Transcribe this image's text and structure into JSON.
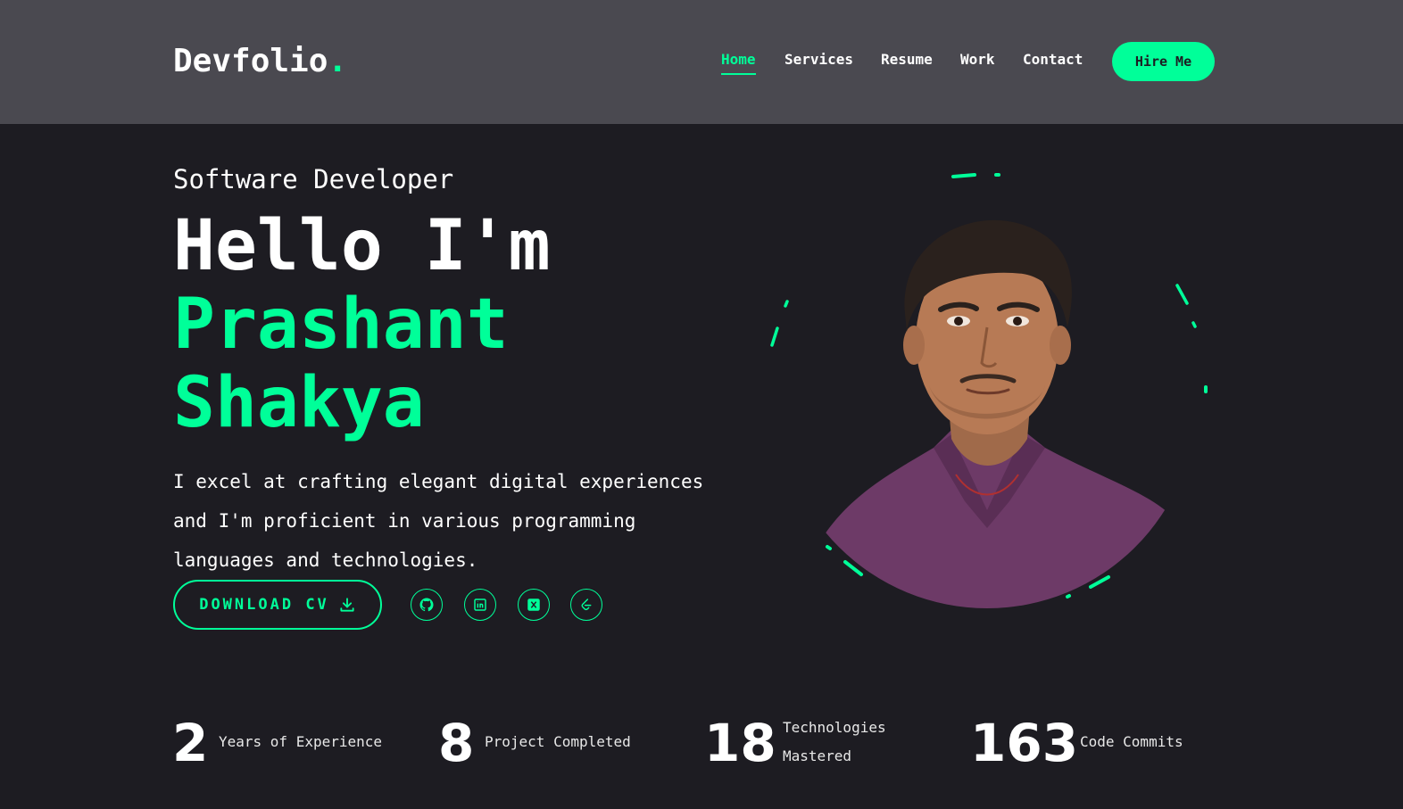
{
  "header": {
    "logo_text": "Devfolio",
    "logo_dot": ".",
    "nav": [
      {
        "label": "Home"
      },
      {
        "label": "Services"
      },
      {
        "label": "Resume"
      },
      {
        "label": "Work"
      },
      {
        "label": "Contact"
      }
    ],
    "hire_label": "Hire Me"
  },
  "hero": {
    "role": "Software Developer",
    "greeting": "Hello I'm",
    "name_line1": "Prashant",
    "name_line2": "Shakya",
    "description_lines": [
      "I excel at crafting elegant digital experiences",
      "and I'm proficient in various programming",
      "languages and technologies."
    ],
    "cv_label": "DOWNLOAD CV",
    "socials": [
      {
        "icon": "github-icon"
      },
      {
        "icon": "linkedin-icon"
      },
      {
        "icon": "x-twitter-icon"
      },
      {
        "icon": "leetcode-icon"
      }
    ]
  },
  "stats": [
    {
      "value": "2",
      "label": "Years of Experience"
    },
    {
      "value": "8",
      "label": "Project Completed"
    },
    {
      "value": "18",
      "label_line1": "Technologies",
      "label_line2": "Mastered"
    },
    {
      "value": "163",
      "label": "Code Commits"
    }
  ],
  "colors": {
    "accent": "#00ff99",
    "background": "#1d1c22",
    "header_bg": "#4a4950",
    "shirt": "#6d3a67"
  }
}
